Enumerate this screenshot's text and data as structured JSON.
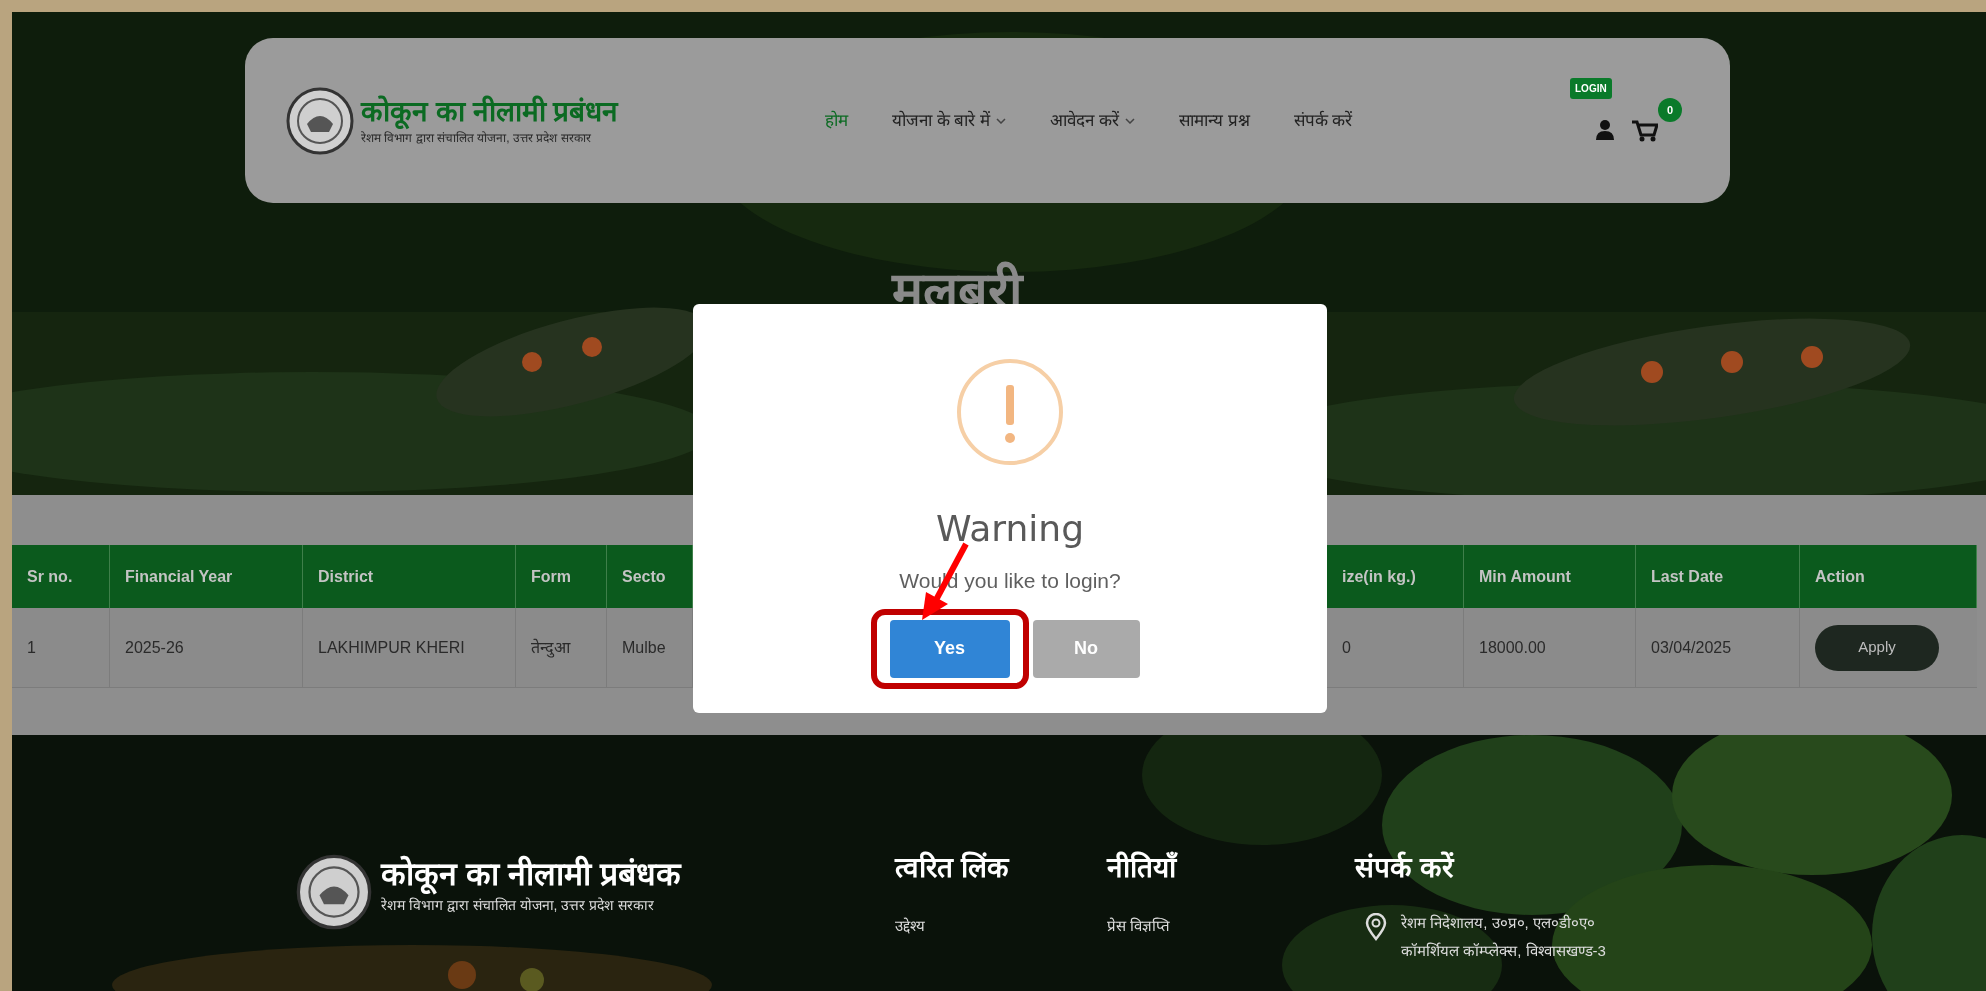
{
  "header": {
    "logo_title": "कोकून का नीलामी प्रबंधन",
    "logo_subtitle": "रेशम विभाग द्वारा संचालित योजना, उत्तर प्रदेश सरकार",
    "nav": [
      {
        "label": "होम",
        "selected": true,
        "dropdown": false
      },
      {
        "label": "योजना के बारे में",
        "selected": false,
        "dropdown": true
      },
      {
        "label": "आवेदन करें",
        "selected": false,
        "dropdown": true
      },
      {
        "label": "सामान्य प्रश्न",
        "selected": false,
        "dropdown": false
      },
      {
        "label": "संपर्क करें",
        "selected": false,
        "dropdown": false
      }
    ],
    "login_badge": "LOGIN",
    "cart_count": "0"
  },
  "hero": {
    "title": "मलबरी"
  },
  "table": {
    "columns": [
      "Sr no.",
      "Financial Year",
      "District",
      "Form",
      "Secto",
      "ize(in kg.)",
      "Min Amount",
      "Last Date",
      "Action"
    ],
    "rows": [
      {
        "cells": [
          "1",
          "2025-26",
          "LAKHIMPUR KHERI",
          "तेन्दुआ",
          "Mulbe",
          "0",
          "18000.00",
          "03/04/2025"
        ],
        "action": "Apply"
      }
    ]
  },
  "dialog": {
    "title": "Warning",
    "message": "Would you like to login?",
    "buttons": [
      {
        "label": "Yes",
        "kind": "confirm"
      },
      {
        "label": "No",
        "kind": "cancel"
      }
    ]
  },
  "footer": {
    "logo_title": "कोकून का नीलामी प्रबंधक",
    "logo_subtitle": "रेशम विभाग द्वारा संचालित योजना, उत्तर प्रदेश सरकार",
    "columns": [
      {
        "heading": "त्वरित लिंक",
        "links": [
          "उद्देश्य"
        ]
      },
      {
        "heading": "नीतियाँ",
        "links": [
          "प्रेस विज्ञप्ति"
        ]
      }
    ],
    "contact": {
      "heading": "संपर्क करें",
      "address": [
        "रेशम निदेशालय, उ०प्र०, एल०डी०ए०",
        "कॉमर्शियल कॉम्प्लेक्स, विश्वासखण्ड-3"
      ]
    }
  }
}
